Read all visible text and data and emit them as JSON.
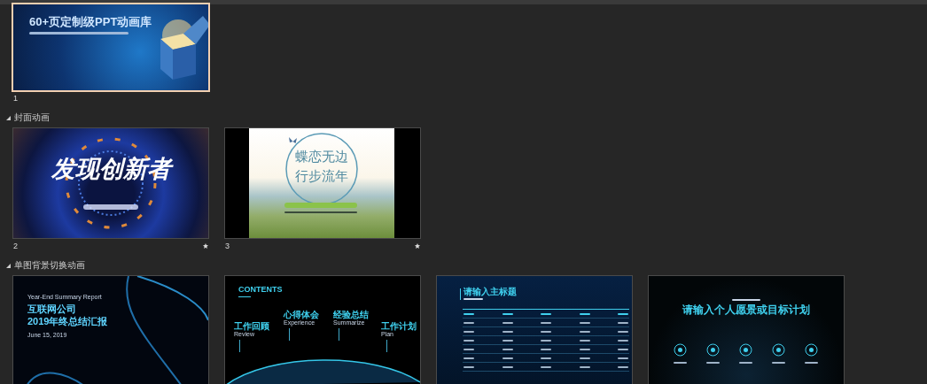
{
  "sections": [
    {
      "slides": [
        {
          "number": "1",
          "selected": true,
          "kind": "box",
          "title": "60+页定制级PPT动画库"
        }
      ]
    },
    {
      "title": "封面动画",
      "expanded": true,
      "slides": [
        {
          "number": "2",
          "selected": false,
          "animated": true,
          "kind": "tech",
          "title": "发现创新者"
        },
        {
          "number": "3",
          "selected": false,
          "animated": true,
          "kind": "landscape",
          "lines": [
            "蝶恋无边",
            "行步流年"
          ]
        }
      ]
    },
    {
      "title": "单图背景切换动画",
      "expanded": true,
      "slides": [
        {
          "selected": false,
          "kind": "globe",
          "kicker": "Year-End Summary Report",
          "lines": [
            "互联网公司",
            "2019年终总结汇报"
          ],
          "date": "June 15, 2019"
        },
        {
          "selected": false,
          "kind": "contents",
          "title": "CONTENTS",
          "items": [
            {
              "label": "工作回顾",
              "en": "Review"
            },
            {
              "label": "心得体会",
              "en": "Experience"
            },
            {
              "label": "经验总结",
              "en": "Summarize"
            },
            {
              "label": "工作计划",
              "en": "Plan"
            }
          ]
        },
        {
          "selected": false,
          "kind": "table",
          "title": "请输入主标题"
        },
        {
          "selected": false,
          "kind": "vision",
          "title": "请输入个人愿景或目标计划"
        }
      ]
    }
  ]
}
